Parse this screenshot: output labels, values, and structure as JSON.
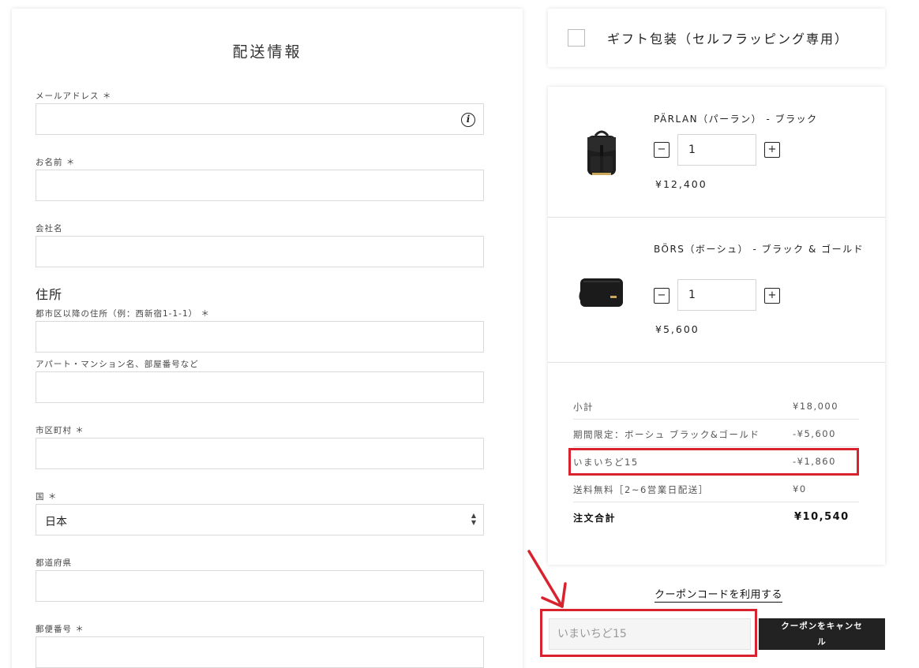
{
  "shipping": {
    "title": "配送情報",
    "email_label": "メールアドレス ＊",
    "name_label": "お名前 ＊",
    "company_label": "会社名",
    "address_heading": "住所",
    "address1_label": "都市区以降の住所（例：西新宿1-1-1） ＊",
    "address2_label": "アパート・マンション名、部屋番号など",
    "city_label": "市区町村 ＊",
    "country_label": "国 ＊",
    "country_value": "日本",
    "prefecture_label": "都道府県",
    "postal_label": "郵便番号 ＊",
    "info_icon": "i",
    "select_arrows": "▲▼"
  },
  "gift": {
    "label": "ギフト包装（セルフラッピング専用）"
  },
  "cart": {
    "items": [
      {
        "name": "PÄRLAN（パーラン） - ブラック",
        "quantity": "1",
        "price": "¥12,400",
        "minus": "−",
        "plus": "+",
        "image": "backpack-black"
      },
      {
        "name": "BÖRS（ボーシュ） - ブラック & ゴールド",
        "quantity": "1",
        "price": "¥5,600",
        "minus": "−",
        "plus": "+",
        "image": "wallet-black"
      }
    ],
    "summary": [
      {
        "label": "小計",
        "value": "¥18,000"
      },
      {
        "label": "期間限定：ボーシュ ブラック&ゴールド",
        "value": "-¥5,600"
      },
      {
        "label": "いまいちど15",
        "value": "-¥1,860"
      },
      {
        "label": "送料無料［2~6営業日配送］",
        "value": "¥0"
      },
      {
        "label": "注文合計",
        "value": "¥10,540"
      }
    ]
  },
  "coupon": {
    "link_label": "クーポンコードを利用する",
    "input_value": "いまいちど15",
    "cancel_button": "クーポンをキャンセル"
  },
  "colors": {
    "accent_red": "#d8232f",
    "button_dark": "#222222"
  }
}
